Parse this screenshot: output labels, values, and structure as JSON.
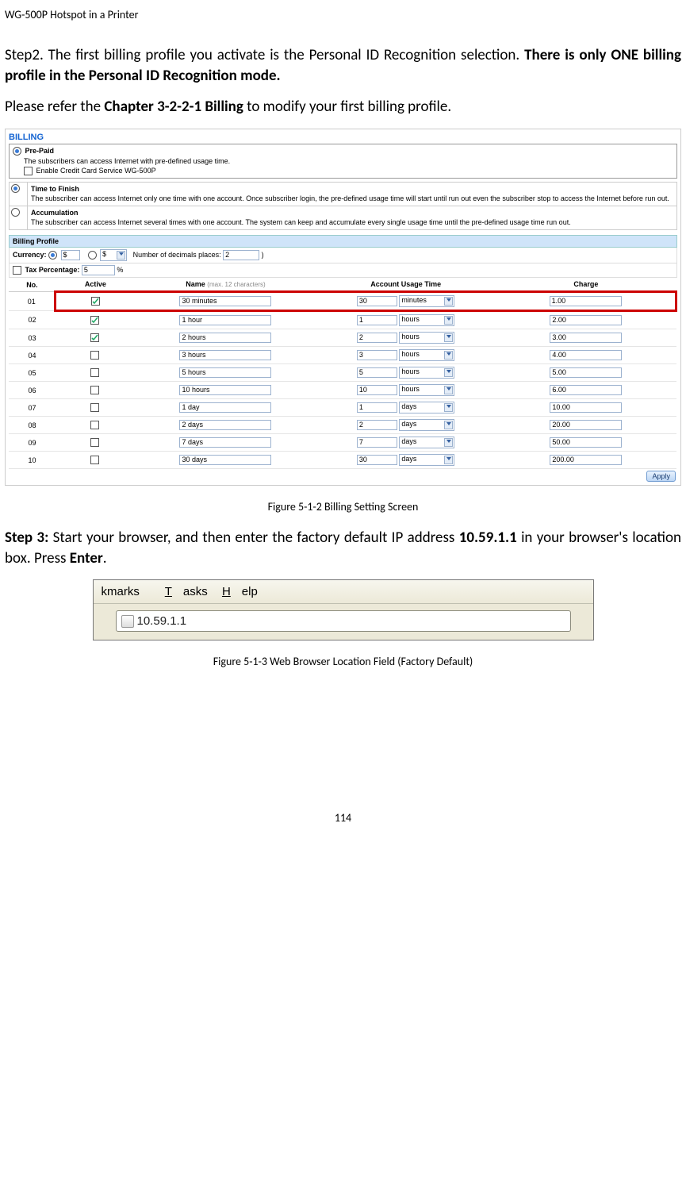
{
  "header": "WG-500P Hotspot in a Printer",
  "step2_a": "Step2. The first billing profile you activate is the Personal ID Recognition selection.",
  "step2_b": "There is only ONE billing profile in the Personal ID Recognition mode.",
  "please_a": "Please refer the ",
  "please_b": "Chapter 3-2-2-1 Billing",
  "please_c": " to modify your first billing profile.",
  "billing": {
    "title": "BILLING",
    "prepaid": "Pre-Paid",
    "prepaid_desc": "The subscribers can access Internet with pre-defined usage time.",
    "enable_cc": "Enable Credit Card Service WG-500P",
    "ttf": "Time to Finish",
    "ttf_desc": "The subscriber can access Internet only one time with one account. Once subscriber login, the pre-defined usage time will start until run out even the subscriber stop to access the Internet before run out.",
    "acc": "Accumulation",
    "acc_desc": "The subscriber can access Internet several times with one account. The system can keep and accumulate every single usage time until the pre-defined usage time run out.",
    "bp": "Billing Profile",
    "currency_label": "Currency:",
    "curr_usd": "$",
    "curr_other": "$",
    "decimals_label": "Number of decimals places:",
    "decimals_val": "2",
    "tax_label": "Tax Percentage:",
    "tax_val": "5",
    "pct": "%",
    "th_no": "No.",
    "th_active": "Active",
    "th_name": "Name",
    "th_name_hint": "(max. 12 characters)",
    "th_usage": "Account Usage Time",
    "th_charge": "Charge",
    "rows": [
      {
        "no": "01",
        "active": true,
        "name": "30 minutes",
        "qty": "30",
        "unit": "minutes",
        "charge": "1.00",
        "hl": true
      },
      {
        "no": "02",
        "active": true,
        "name": "1 hour",
        "qty": "1",
        "unit": "hours",
        "charge": "2.00"
      },
      {
        "no": "03",
        "active": true,
        "name": "2 hours",
        "qty": "2",
        "unit": "hours",
        "charge": "3.00"
      },
      {
        "no": "04",
        "active": false,
        "name": "3 hours",
        "qty": "3",
        "unit": "hours",
        "charge": "4.00"
      },
      {
        "no": "05",
        "active": false,
        "name": "5 hours",
        "qty": "5",
        "unit": "hours",
        "charge": "5.00"
      },
      {
        "no": "06",
        "active": false,
        "name": "10 hours",
        "qty": "10",
        "unit": "hours",
        "charge": "6.00"
      },
      {
        "no": "07",
        "active": false,
        "name": "1 day",
        "qty": "1",
        "unit": "days",
        "charge": "10.00"
      },
      {
        "no": "08",
        "active": false,
        "name": "2 days",
        "qty": "2",
        "unit": "days",
        "charge": "20.00"
      },
      {
        "no": "09",
        "active": false,
        "name": "7 days",
        "qty": "7",
        "unit": "days",
        "charge": "50.00"
      },
      {
        "no": "10",
        "active": false,
        "name": "30 days",
        "qty": "30",
        "unit": "days",
        "charge": "200.00"
      }
    ],
    "apply": "Apply"
  },
  "fig512": "Figure 5-1-2 Billing Setting Screen",
  "step3_a": "Step 3:",
  "step3_b": " Start your browser, and then enter the factory default IP address ",
  "step3_ip": "10.59.1.1",
  "step3_c": " in your browser's location box. Press ",
  "step3_enter": "Enter",
  "step3_d": ".",
  "browser": {
    "menu_kmarks": "kmarks",
    "menu_tasks": "Tasks",
    "menu_help": "Help",
    "url": "10.59.1.1"
  },
  "fig513": "Figure 5-1-3 Web Browser Location Field (Factory Default)",
  "page_num": "114"
}
